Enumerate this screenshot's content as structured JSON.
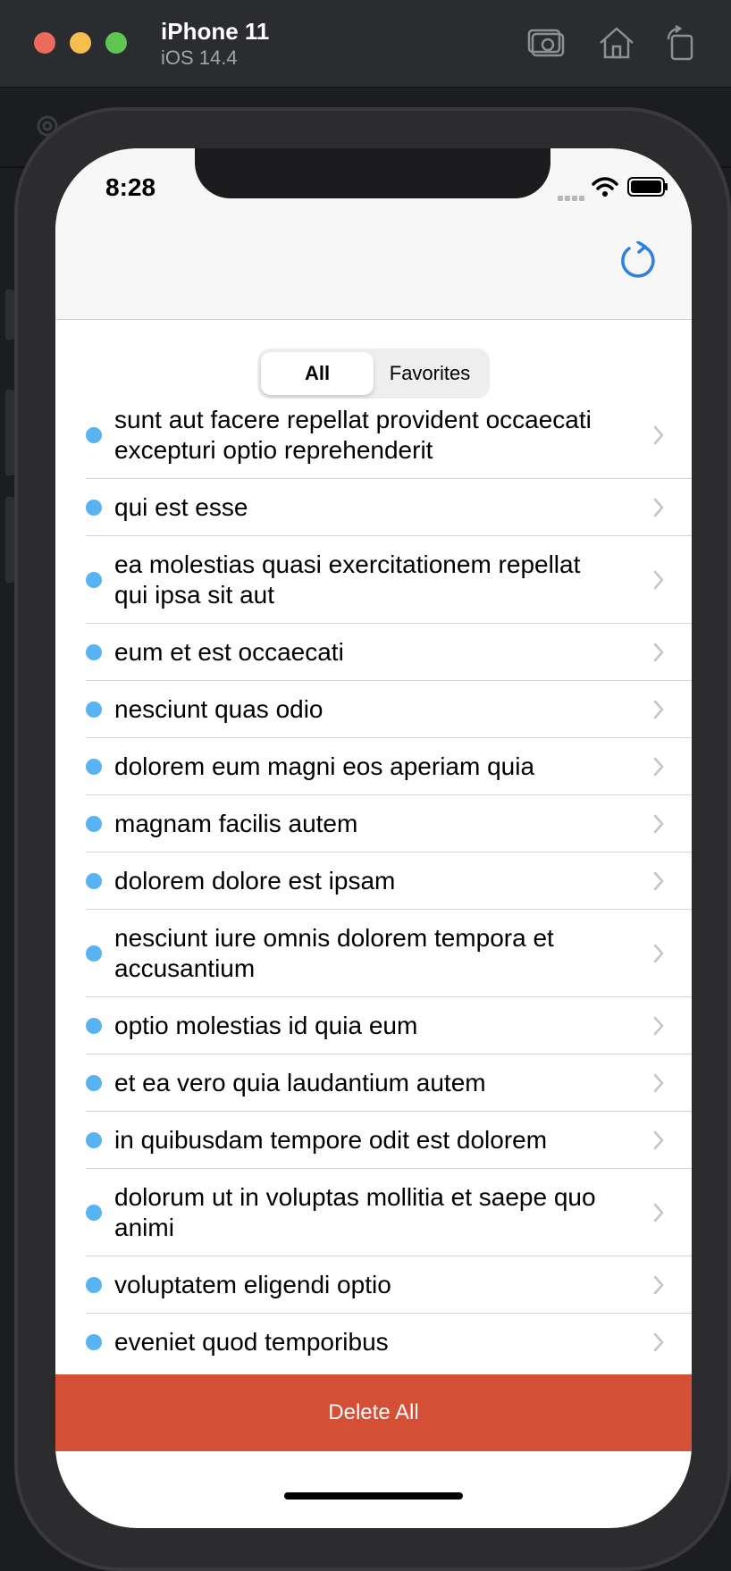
{
  "simulator": {
    "device_name": "iPhone 11",
    "os_version": "iOS 14.4"
  },
  "status_bar": {
    "time": "8:28"
  },
  "segmented": {
    "options": [
      "All",
      "Favorites"
    ],
    "selected": "All"
  },
  "posts": [
    {
      "title": "sunt aut facere repellat provident occaecati excepturi optio reprehenderit",
      "lines": 2
    },
    {
      "title": "qui est esse",
      "lines": 1
    },
    {
      "title": "ea molestias quasi exercitationem repellat qui ipsa sit aut",
      "lines": 2
    },
    {
      "title": "eum et est occaecati",
      "lines": 1
    },
    {
      "title": "nesciunt quas odio",
      "lines": 1
    },
    {
      "title": "dolorem eum magni eos aperiam quia",
      "lines": 1
    },
    {
      "title": "magnam facilis autem",
      "lines": 1
    },
    {
      "title": "dolorem dolore est ipsam",
      "lines": 1
    },
    {
      "title": "nesciunt iure omnis dolorem tempora et accusantium",
      "lines": 2
    },
    {
      "title": "optio molestias id quia eum",
      "lines": 1
    },
    {
      "title": "et ea vero quia laudantium autem",
      "lines": 1
    },
    {
      "title": "in quibusdam tempore odit est dolorem",
      "lines": 1
    },
    {
      "title": "dolorum ut in voluptas mollitia et saepe quo animi",
      "lines": 2
    },
    {
      "title": "voluptatem eligendi optio",
      "lines": 1
    },
    {
      "title": "eveniet quod temporibus",
      "lines": 1
    }
  ],
  "actions": {
    "delete_all_label": "Delete All"
  },
  "colors": {
    "accent_blue": "#57b3f2",
    "refresh_blue": "#2f7fe6",
    "delete_red": "#d34f36"
  }
}
